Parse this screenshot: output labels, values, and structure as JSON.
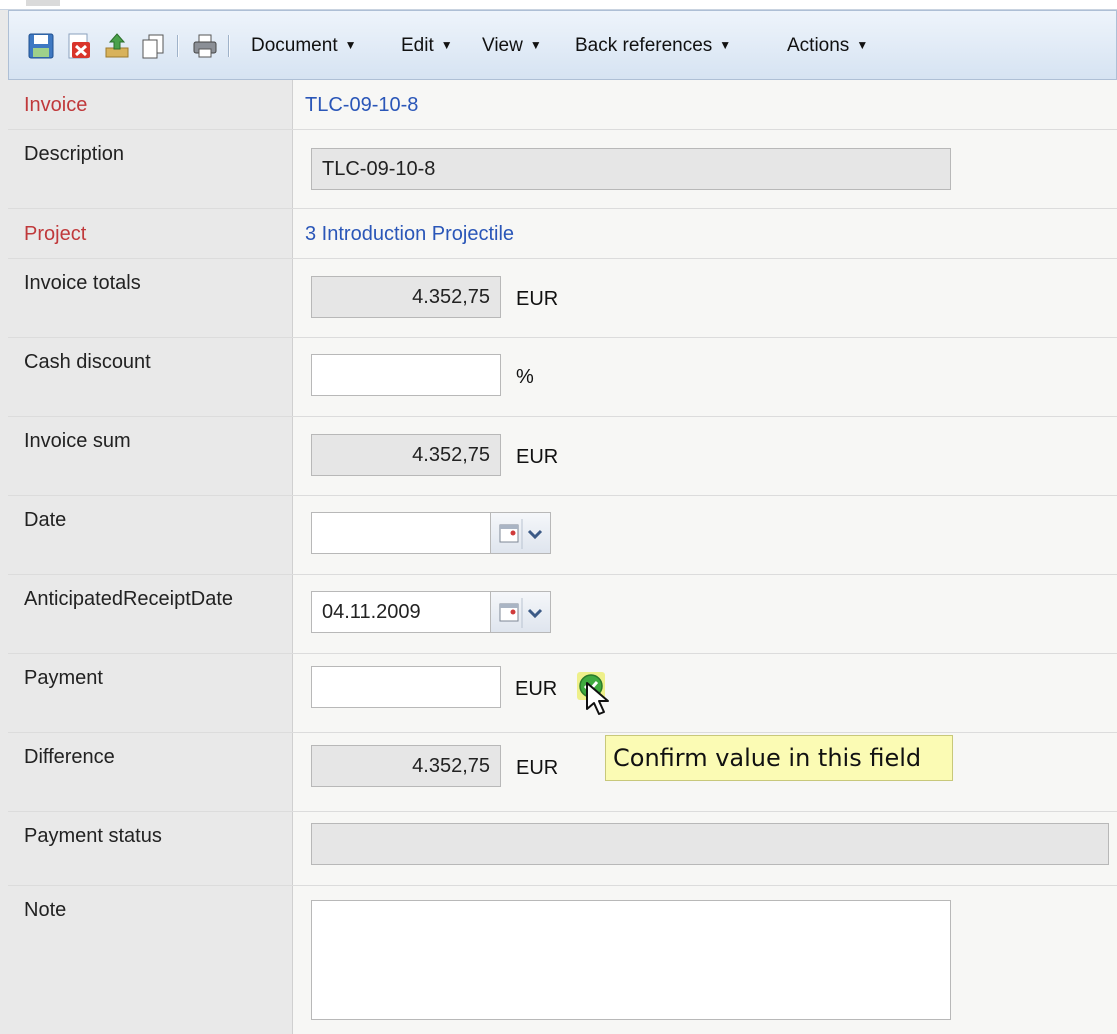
{
  "toolbar": {
    "icons": [
      "save-icon",
      "delete-icon",
      "upload-icon",
      "copy-icon",
      "print-icon"
    ],
    "menus": [
      {
        "label": "Document"
      },
      {
        "label": "Edit"
      },
      {
        "label": "View"
      },
      {
        "label": "Back references"
      },
      {
        "label": "Actions"
      }
    ]
  },
  "form": {
    "invoice": {
      "label": "Invoice",
      "value": "TLC-09-10-8"
    },
    "description": {
      "label": "Description",
      "value": "TLC-09-10-8"
    },
    "project": {
      "label": "Project",
      "value": "3 Introduction Projectile"
    },
    "invoice_totals": {
      "label": "Invoice totals",
      "value": "4.352,75",
      "unit": "EUR"
    },
    "cash_discount": {
      "label": "Cash discount",
      "value": "",
      "unit": "%"
    },
    "invoice_sum": {
      "label": "Invoice sum",
      "value": "4.352,75",
      "unit": "EUR"
    },
    "date": {
      "label": "Date",
      "value": ""
    },
    "anticipated_receipt_date": {
      "label": "AnticipatedReceiptDate",
      "value": "04.11.2009"
    },
    "payment": {
      "label": "Payment",
      "value": "",
      "unit": "EUR"
    },
    "difference": {
      "label": "Difference",
      "value": "4.352,75",
      "unit": "EUR"
    },
    "payment_status": {
      "label": "Payment status",
      "value": ""
    },
    "note": {
      "label": "Note",
      "value": ""
    }
  },
  "tooltip": {
    "text": "Confirm value in this field"
  },
  "colors": {
    "label_red": "#c0393b",
    "link_blue": "#2a56b8",
    "tooltip_bg": "#fbfbb4",
    "confirm_green": "#3faa3f"
  }
}
